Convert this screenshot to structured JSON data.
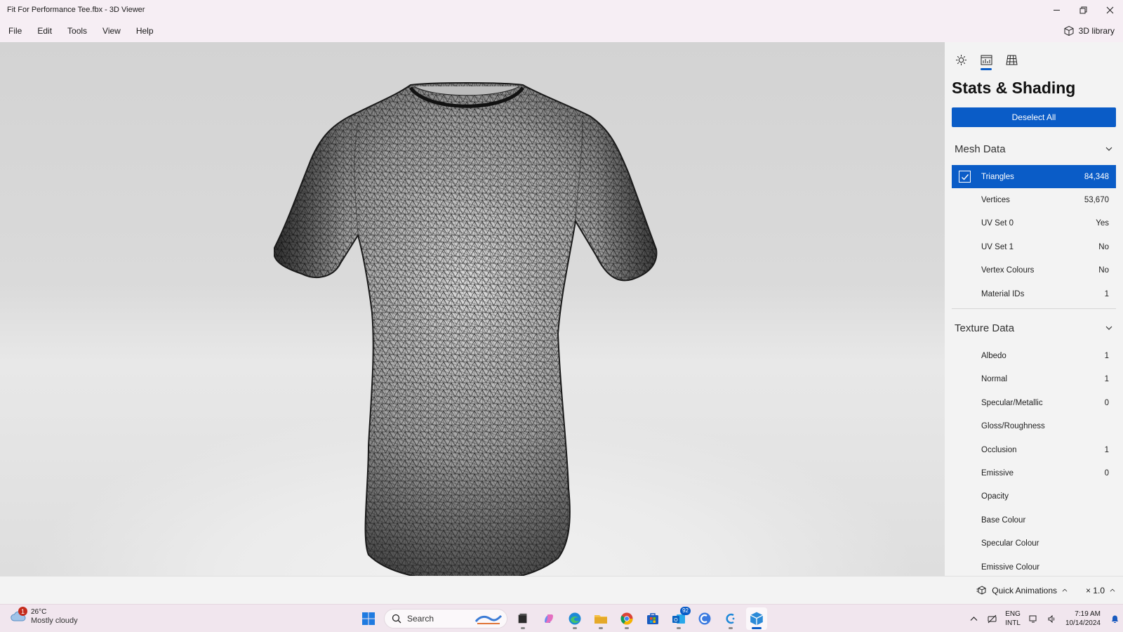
{
  "window": {
    "title": "Fit For Performance Tee.fbx - 3D Viewer",
    "controls": {
      "minimize": "minimize-icon",
      "restore": "restore-icon",
      "close": "close-icon"
    }
  },
  "menu": {
    "items": [
      "File",
      "Edit",
      "Tools",
      "View",
      "Help"
    ],
    "library_label": "3D library"
  },
  "panel": {
    "tabs": [
      {
        "icon": "lighting-icon",
        "active": false
      },
      {
        "icon": "stats-icon",
        "active": true
      },
      {
        "icon": "grid-icon",
        "active": false
      }
    ],
    "title": "Stats & Shading",
    "deselect_label": "Deselect All",
    "mesh": {
      "heading": "Mesh Data",
      "rows": [
        {
          "label": "Triangles",
          "value": "84,348",
          "selected": true
        },
        {
          "label": "Vertices",
          "value": "53,670"
        },
        {
          "label": "UV Set 0",
          "value": "Yes"
        },
        {
          "label": "UV Set 1",
          "value": "No"
        },
        {
          "label": "Vertex Colours",
          "value": "No"
        },
        {
          "label": "Material IDs",
          "value": "1"
        }
      ]
    },
    "texture": {
      "heading": "Texture Data",
      "rows": [
        {
          "label": "Albedo",
          "value": "1"
        },
        {
          "label": "Normal",
          "value": "1"
        },
        {
          "label": "Specular/Metallic",
          "value": "0"
        },
        {
          "label": "Gloss/Roughness",
          "value": ""
        },
        {
          "label": "Occlusion",
          "value": "1"
        },
        {
          "label": "Emissive",
          "value": "0"
        },
        {
          "label": "Opacity",
          "value": ""
        },
        {
          "label": "Base Colour",
          "value": ""
        },
        {
          "label": "Specular Colour",
          "value": ""
        },
        {
          "label": "Emissive Colour",
          "value": ""
        }
      ]
    }
  },
  "status": {
    "quick_animations": "Quick Animations",
    "speed": "× 1.0"
  },
  "taskbar": {
    "weather": {
      "temp": "26°C",
      "condition": "Mostly cloudy",
      "badge": "1"
    },
    "search_placeholder": "Search",
    "apps": [
      {
        "icon": "file-explorer-dark-icon"
      },
      {
        "icon": "copilot-icon"
      },
      {
        "icon": "edge-icon"
      },
      {
        "icon": "folder-icon"
      },
      {
        "icon": "chrome-icon"
      },
      {
        "icon": "store-icon"
      },
      {
        "icon": "outlook-icon",
        "badge": "92"
      },
      {
        "icon": "copilot-app-icon"
      },
      {
        "icon": "c-app-icon"
      },
      {
        "icon": "3d-viewer-icon",
        "active": true
      }
    ],
    "lang": {
      "line1": "ENG",
      "line2": "INTL"
    },
    "clock": {
      "time": "7:19 AM",
      "date": "10/14/2024"
    }
  },
  "colors": {
    "accent": "#0a5cc7",
    "titlebar": "#f6eef4",
    "panel": "#f3f3f3"
  }
}
